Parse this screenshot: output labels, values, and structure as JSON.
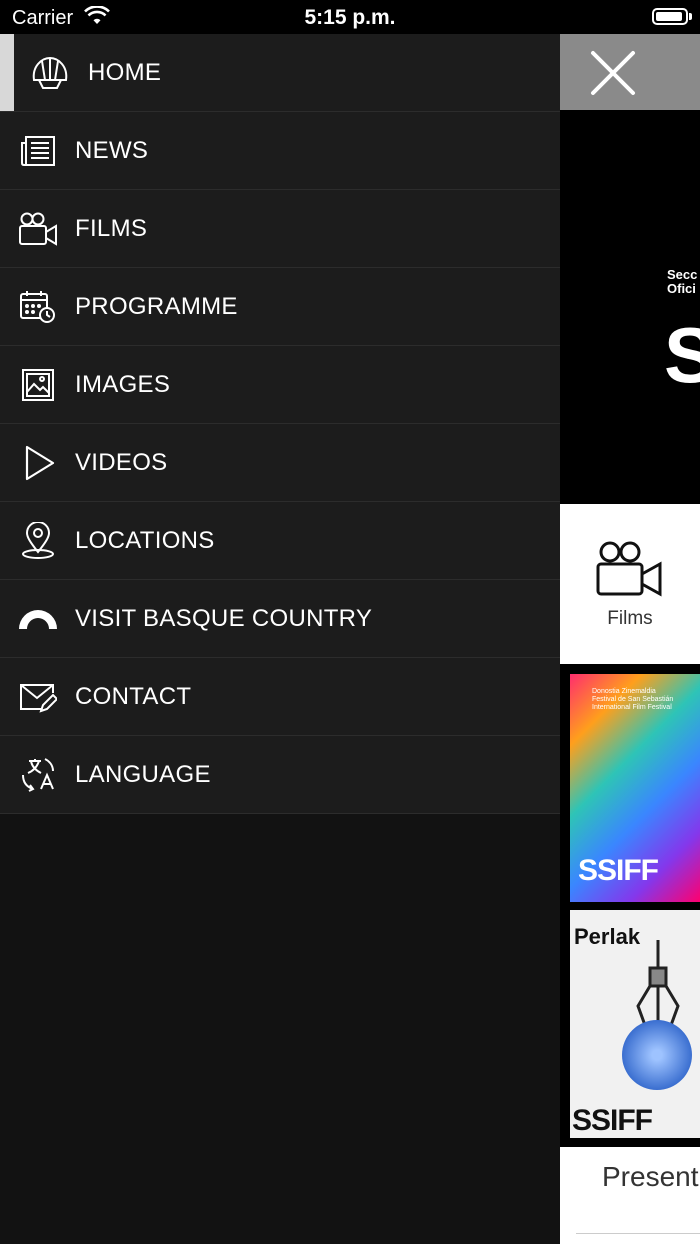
{
  "status_bar": {
    "carrier": "Carrier",
    "time": "5:15 p.m."
  },
  "menu": {
    "items": [
      {
        "label": "HOME",
        "icon": "shell-icon",
        "active": true
      },
      {
        "label": "NEWS",
        "icon": "newspaper-icon"
      },
      {
        "label": "FILMS",
        "icon": "video-camera-icon"
      },
      {
        "label": "PROGRAMME",
        "icon": "calendar-clock-icon"
      },
      {
        "label": "IMAGES",
        "icon": "image-icon"
      },
      {
        "label": "VIDEOS",
        "icon": "play-icon"
      },
      {
        "label": "LOCATIONS",
        "icon": "map-pin-icon"
      },
      {
        "label": "VISIT BASQUE COUNTRY",
        "icon": "arch-icon"
      },
      {
        "label": "CONTACT",
        "icon": "mail-edit-icon"
      },
      {
        "label": "LANGUAGE",
        "icon": "translate-icon"
      }
    ]
  },
  "background": {
    "banner_line1": "Secc",
    "banner_line2": "Ofici",
    "banner_big": "S",
    "quick_link_label": "Films",
    "poster1_title": "SSIFF",
    "poster1_top_line1": "Donostia Zinemaldia",
    "poster1_top_line2": "Festival de San Sebastián",
    "poster1_top_line3": "International Film Festival",
    "poster2_name": "Perlak",
    "poster2_title": "SSIFF",
    "present_text": "Present"
  },
  "colors": {
    "drawer": "#1c1c1c",
    "active_indicator": "#d8d8d8",
    "close_bg": "#8a8a8a"
  }
}
